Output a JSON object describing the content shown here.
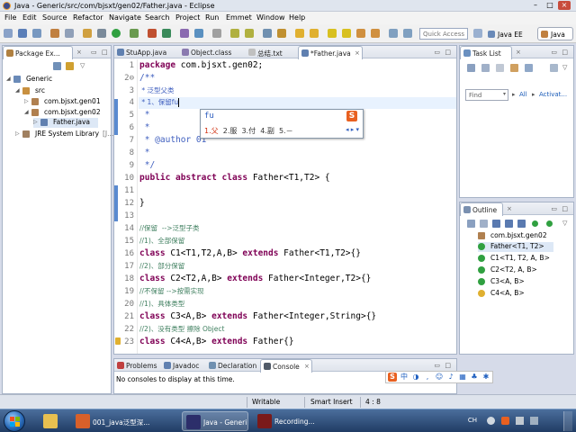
{
  "window": {
    "title": "Java - Generic/src/com/bjsxt/gen02/Father.java - Eclipse"
  },
  "menu": [
    "File",
    "Edit",
    "Source",
    "Refactor",
    "Navigate",
    "Search",
    "Project",
    "Run",
    "Emmet",
    "Window",
    "Help"
  ],
  "toolbar": {
    "quick_access": "Quick Access",
    "persp_java_ee": "Java EE",
    "persp_java": "Java"
  },
  "package_explorer": {
    "tab": "Package Ex...",
    "tree": [
      "Generic",
      "src",
      "com.bjsxt.gen01",
      "com.bjsxt.gen02",
      "Father.java",
      "JRE System Library",
      "[J..."
    ]
  },
  "editor": {
    "tabs": [
      "StuApp.java",
      "Object.class",
      "总结.txt",
      "*Father.java"
    ],
    "lines": [
      {
        "n": "1",
        "t": "package com.bjsxt.gen02;"
      },
      {
        "n": "2⊖",
        "t": "/**"
      },
      {
        "n": "3",
        "t": " * 泛型父类"
      },
      {
        "n": "4",
        "t": " * 1、保留fu"
      },
      {
        "n": "5",
        "t": " *"
      },
      {
        "n": "6",
        "t": " *"
      },
      {
        "n": "7",
        "t": " * @author 01"
      },
      {
        "n": "8",
        "t": " *"
      },
      {
        "n": "9",
        "t": " */"
      },
      {
        "n": "10",
        "t": "public abstract class Father<T1,T2> {"
      },
      {
        "n": "11",
        "t": ""
      },
      {
        "n": "12",
        "t": "}"
      },
      {
        "n": "13",
        "t": ""
      },
      {
        "n": "14",
        "t": "//保留  -->泛型子类"
      },
      {
        "n": "15",
        "t": "//1)、全部保留"
      },
      {
        "n": "16",
        "t": "class C1<T1,T2,A,B> extends Father<T1,T2>{}"
      },
      {
        "n": "17",
        "t": "//2)、部分保留"
      },
      {
        "n": "18",
        "t": "class C2<T2,A,B> extends Father<Integer,T2>{}"
      },
      {
        "n": "19",
        "t": "//不保留 -->按需实现"
      },
      {
        "n": "20",
        "t": "//1)、具体类型"
      },
      {
        "n": "21",
        "t": "class C3<A,B> extends Father<Integer,String>{}"
      },
      {
        "n": "22",
        "t": "//2)、没有类型 擦除 Object"
      },
      {
        "n": "23",
        "t": "class C4<A,B> extends Father{}"
      }
    ]
  },
  "ime": {
    "composition": "fu",
    "candidates": [
      "1.父",
      "2.服",
      "3.付",
      "4.副",
      "5.－"
    ],
    "logo": "S"
  },
  "task_list": {
    "tab": "Task List",
    "find": "Find",
    "all": "All",
    "activate": "Activat..."
  },
  "outline": {
    "tab": "Outline",
    "items": [
      "com.bjsxt.gen02",
      "Father<T1, T2>",
      "C1<T1, T2, A, B>",
      "C2<T2, A, B>",
      "C3<A, B>",
      "C4<A, B>"
    ]
  },
  "bottom_panel": {
    "tabs": [
      "Problems",
      "Javadoc",
      "Declaration",
      "Console"
    ],
    "message": "No consoles to display at this time."
  },
  "status": {
    "writable": "Writable",
    "insert_mode": "Smart Insert",
    "position": "4 : 8"
  },
  "taskbar": {
    "items": [
      "001_java泛型深...",
      "Java - Generic/s...",
      "Recording..."
    ],
    "tray": "CH"
  },
  "colors": {
    "keyword": "#7f0055",
    "comment": "#3f7f5f",
    "javadoc": "#3f5fbf",
    "accent": "#e86020"
  }
}
